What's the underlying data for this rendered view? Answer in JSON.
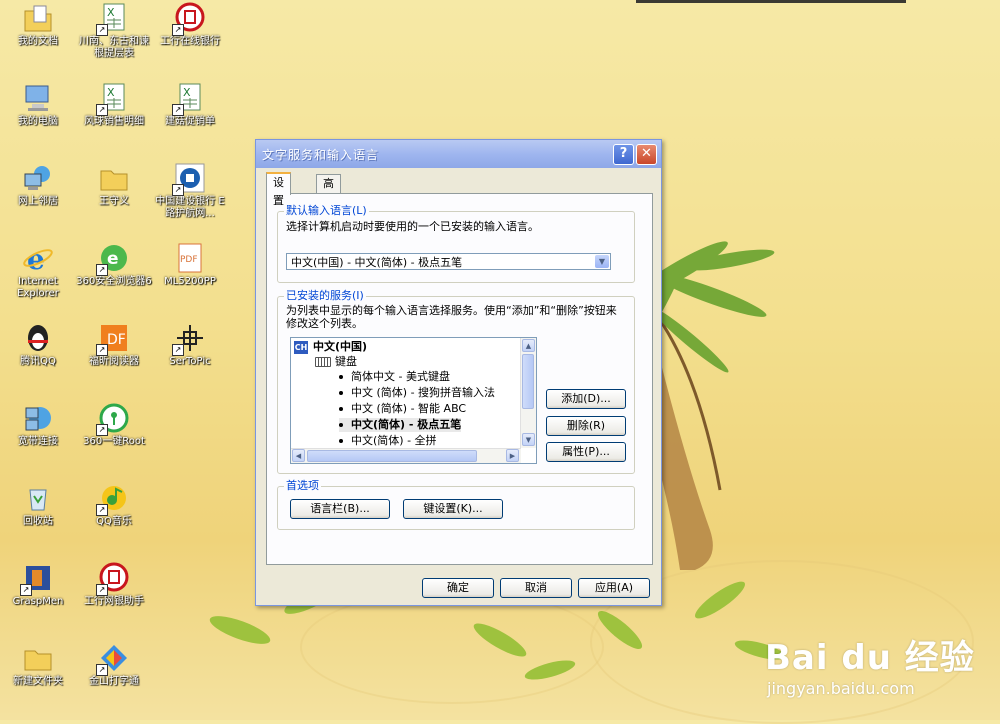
{
  "desktop_icons": [
    {
      "label": "我的文档"
    },
    {
      "label": "川南、东古和谏根提层表"
    },
    {
      "label": "工行在线银行"
    },
    {
      "label": "我的电脑"
    },
    {
      "label": "风球销售明细"
    },
    {
      "label": "建菇促销单"
    },
    {
      "label": "网上邻居"
    },
    {
      "label": "王守义"
    },
    {
      "label": "中国建设银行 E路护航网..."
    },
    {
      "label": "Internet Explorer"
    },
    {
      "label": "360安全浏览器6"
    },
    {
      "label": "ML5200PP"
    },
    {
      "label": "腾讯QQ"
    },
    {
      "label": "福昕阅读器"
    },
    {
      "label": "SerToPic"
    },
    {
      "label": "宽带连接"
    },
    {
      "label": "360一键Root"
    },
    {
      "label": "回收站"
    },
    {
      "label": "QQ音乐"
    },
    {
      "label": "GraspMen"
    },
    {
      "label": "工行网银助手"
    },
    {
      "label": "新建文件夹"
    },
    {
      "label": "金山打字通"
    }
  ],
  "dialog": {
    "title": "文字服务和输入语言",
    "help_glyph": "?",
    "close_glyph": "✕",
    "tabs": [
      {
        "label": "设置"
      },
      {
        "label": "高级"
      }
    ],
    "default_lang": {
      "legend": "默认输入语言(L)",
      "description": "选择计算机启动时要使用的一个已安装的输入语言。",
      "selected": "中文(中国) - 中文(简体) - 极点五笔"
    },
    "installed": {
      "legend": "已安装的服务(I)",
      "description": "为列表中显示的每个输入语言选择服务。使用“添加”和“删除”按钮来修改这个列表。",
      "language": "中文(中国)",
      "lang_badge": "CH",
      "category": "键盘",
      "items": [
        "简体中文 - 美式键盘",
        "中文 (简体) - 搜狗拼音输入法",
        "中文 (简体) - 智能 ABC",
        "中文(简体) - 极点五笔",
        "中文(简体) - 全拼"
      ],
      "add_label": "添加(D)...",
      "remove_label": "删除(R)",
      "properties_label": "属性(P)..."
    },
    "prefs": {
      "legend": "首选项",
      "langbar_label": "语言栏(B)...",
      "keysettings_label": "键设置(K)..."
    },
    "ok_label": "确定",
    "cancel_label": "取消",
    "apply_label": "应用(A)"
  },
  "watermark": {
    "brand": "Bai du 经验",
    "url": "jingyan.baidu.com"
  }
}
